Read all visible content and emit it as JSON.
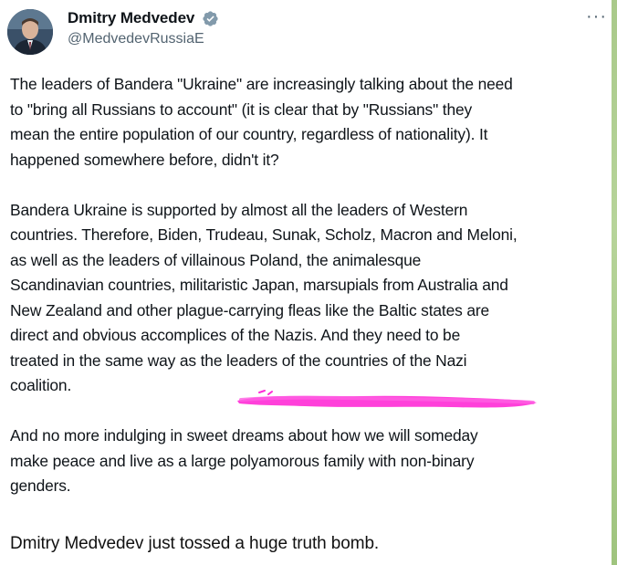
{
  "post": {
    "author_name": "Dmitry Medvedev",
    "author_handle": "@MedvedevRussiaE",
    "verified": true,
    "more_icon": "more-horizontal-icon",
    "paragraphs": [
      "The leaders of Bandera \"Ukraine\" are increasingly talking about the need\nto \"bring all Russians to account\" (it is clear that by \"Russians\" they\nmean the entire population of our country, regardless of nationality). It\nhappened somewhere before, didn't it?",
      "Bandera Ukraine is supported by almost all the leaders of Western\ncountries. Therefore, Biden, Trudeau, Sunak, Scholz, Macron and Meloni,\nas well as the leaders of villainous Poland, the animalesque\nScandinavian countries, militaristic Japan, marsupials from Australia and\nNew Zealand and other plague-carrying fleas like the Baltic states are\ndirect and obvious accomplices of the Nazis. And they need to be\ntreated in the same way as the leaders of the countries of the Nazi\ncoalition.",
      "And no more indulging in sweet dreams about how we will someday\nmake peace and live as a large polyamorous family with non-binary\ngenders."
    ],
    "highlight_color": "#ff2bd6",
    "badge_color": "#829aab"
  },
  "caption": "Dmitry Medvedev just tossed a huge truth bomb."
}
